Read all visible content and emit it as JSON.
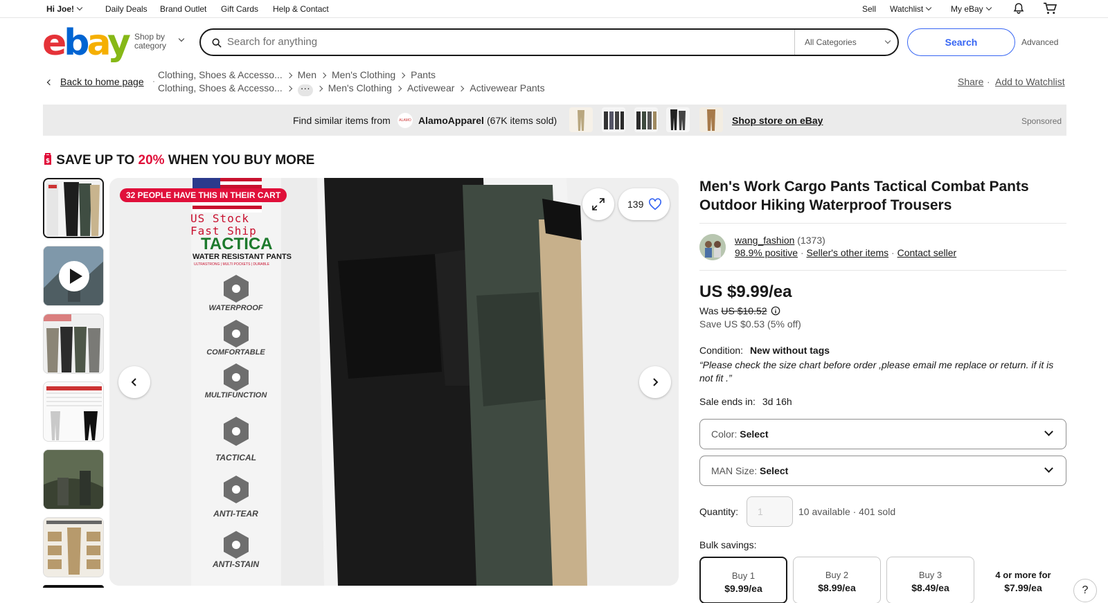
{
  "topbar": {
    "greeting": "Hi Joe!",
    "links": [
      "Daily Deals",
      "Brand Outlet",
      "Gift Cards",
      "Help & Contact"
    ],
    "sell": "Sell",
    "watchlist": "Watchlist",
    "my_ebay": "My eBay"
  },
  "header": {
    "logo": {
      "e": "e",
      "b": "b",
      "a": "a",
      "y": "y"
    },
    "shop_by_line1": "Shop by",
    "shop_by_line2": "category",
    "search_placeholder": "Search for anything",
    "category": "All Categories",
    "search_button": "Search",
    "advanced": "Advanced"
  },
  "breadcrumb": {
    "back": "Back to home page",
    "row1": [
      "Clothing, Shoes & Accesso...",
      "Men",
      "Men's Clothing",
      "Pants"
    ],
    "row2": [
      "Clothing, Shoes & Accesso...",
      "Men's Clothing",
      "Activewear",
      "Activewear Pants"
    ],
    "share": "Share",
    "add_watchlist": "Add to Watchlist"
  },
  "banner": {
    "find_text": "Find similar items from",
    "store_name": "AlamoApparel",
    "items_sold": "(67K items sold)",
    "shop_store": "Shop store on eBay",
    "sponsored": "Sponsored",
    "logo_text": "ALAMO"
  },
  "save_banner": {
    "prefix": "SAVE UP TO",
    "pct": "20%",
    "suffix": "WHEN YOU BUY MORE"
  },
  "main_image": {
    "cart_badge": "32 PEOPLE HAVE THIS IN THEIR CART",
    "us_stock": "US Stock",
    "fast_ship": "Fast Ship",
    "brand": "TACTICA",
    "subtitle": "WATER RESISTANT PANTS",
    "tagline": "ULTRASTRONG | MULTI POCKETS | DURABLE",
    "features": [
      "WATERPROOF",
      "COMFORTABLE",
      "MULTIFUNCTION",
      "TACTICAL",
      "ANTI-TEAR",
      "ANTI-STAIN"
    ],
    "watchers": "139"
  },
  "product": {
    "title": "Men's Work Cargo Pants Tactical Combat Pants Outdoor Hiking Waterproof Trousers",
    "seller_name": "wang_fashion",
    "seller_score": "(1373)",
    "positive": "98.9% positive",
    "other_items": "Seller's other items",
    "contact": "Contact seller",
    "price": "US $9.99/ea",
    "was_label": "Was",
    "was_price": "US $10.52",
    "save_text": "Save US $0.53 (5% off)",
    "condition_label": "Condition:",
    "condition_value": "New without tags",
    "note": "“Please check the size chart before order ,please email me replace or return. if it is not fit .”",
    "sale_label": "Sale ends in:",
    "sale_value": "3d 16h",
    "color_label": "Color:",
    "color_value": "Select",
    "size_label": "MAN Size:",
    "size_value": "Select",
    "quantity_label": "Quantity:",
    "quantity_value": "1",
    "available": "10 available",
    "sold": "· 401 sold",
    "bulk_label": "Bulk savings:",
    "bulk": [
      {
        "qty": "Buy 1",
        "price": "$9.99/ea"
      },
      {
        "qty": "Buy 2",
        "price": "$8.99/ea"
      },
      {
        "qty": "Buy 3",
        "price": "$8.49/ea"
      },
      {
        "qty": "4 or more for",
        "price": "$7.99/ea"
      }
    ]
  },
  "help": "?"
}
